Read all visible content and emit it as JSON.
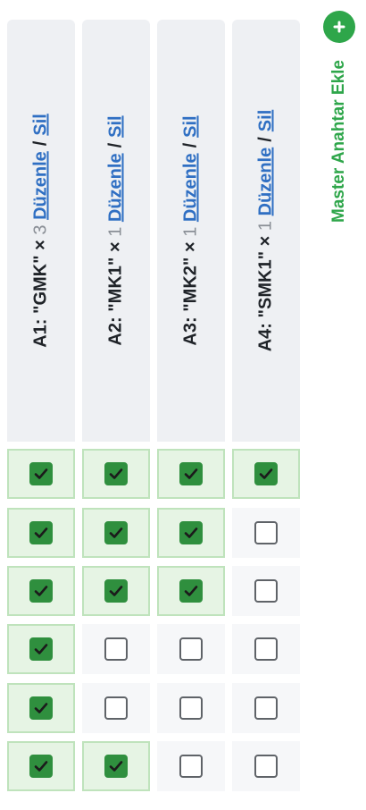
{
  "columns": [
    {
      "code": "A1: \"GMK\" ×",
      "count": "3",
      "edit_label": "Düzenle",
      "delete_label": "Sil"
    },
    {
      "code": "A2: \"MK1\" ×",
      "count": "1",
      "edit_label": "Düzenle",
      "delete_label": "Sil"
    },
    {
      "code": "A3: \"MK2\" ×",
      "count": "1",
      "edit_label": "Düzenle",
      "delete_label": "Sil"
    },
    {
      "code": "A4: \"SMK1\" ×",
      "count": "1",
      "edit_label": "Düzenle",
      "delete_label": "Sil"
    }
  ],
  "separator": "/",
  "grid": [
    [
      true,
      true,
      true,
      true
    ],
    [
      true,
      true,
      true,
      false
    ],
    [
      true,
      true,
      true,
      false
    ],
    [
      true,
      false,
      false,
      false
    ],
    [
      true,
      false,
      false,
      false
    ],
    [
      true,
      true,
      false,
      false
    ]
  ],
  "add_master_key": {
    "label": "Master Anahtar Ekle",
    "icon": "plus-icon"
  },
  "colors": {
    "accent_green": "#2ea64a",
    "checkbox_green": "#2f8f3e",
    "link_blue": "#2f6fc3",
    "header_bg": "#eef0f3"
  }
}
